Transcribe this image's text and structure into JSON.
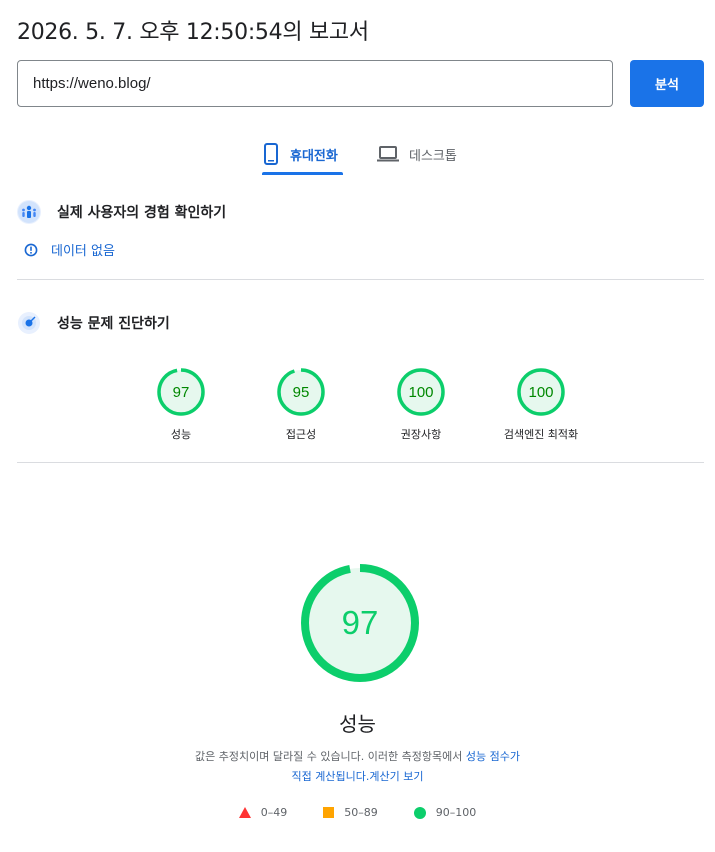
{
  "report": {
    "title": "2026. 5. 7. 오후 12:50:54의 보고서"
  },
  "url_input": {
    "value": "https://weno.blog/"
  },
  "analyze_button": {
    "label": "분석"
  },
  "tabs": [
    {
      "label": "휴대전화",
      "icon": "phone-icon",
      "active": true
    },
    {
      "label": "데스크톱",
      "icon": "laptop-icon",
      "active": false
    }
  ],
  "field_data": {
    "title": "실제 사용자의 경험 확인하기",
    "no_data_label": "데이터 없음"
  },
  "lab_data": {
    "title": "성능 문제 진단하기",
    "scores": [
      {
        "label": "성능",
        "score": 97
      },
      {
        "label": "접근성",
        "score": 95
      },
      {
        "label": "권장사항",
        "score": 100
      },
      {
        "label": "검색엔진 최적화",
        "score": 100
      }
    ]
  },
  "performance": {
    "score": 97,
    "label": "성능",
    "desc_text": "값은 추정치이며 달라질 수 있습니다. 이러한 측정항목에서 ",
    "desc_link_1": "성능 점수가",
    "desc_link_2": "직접 계산됩니다.",
    "calc_link": "계산기 보기"
  },
  "legend": [
    {
      "range": "0–49",
      "shape": "triangle",
      "color": "#f33"
    },
    {
      "range": "50–89",
      "shape": "square",
      "color": "#ffa400"
    },
    {
      "range": "90–100",
      "shape": "circle",
      "color": "#0cce6b"
    }
  ],
  "colors": {
    "accent": "#1a73e8",
    "pass": "#0cce6b",
    "pass_fill": "#e6f8ee",
    "pass_text": "#008800",
    "link": "#1967d2"
  }
}
